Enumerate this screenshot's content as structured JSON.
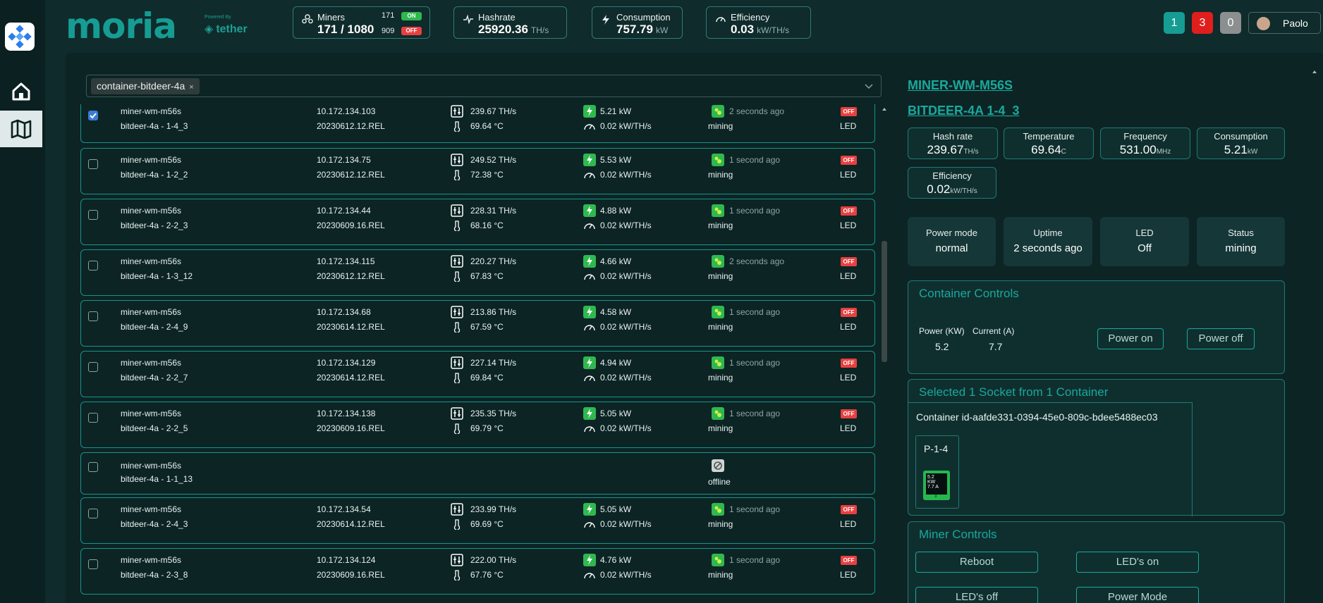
{
  "brand": {
    "name": "moria",
    "powered_by": "Powered By",
    "partner": "tether"
  },
  "stats": {
    "miners": {
      "label": "Miners",
      "value": "171 / 1080",
      "on_count": "171",
      "off_count": "909",
      "on_label": "ON",
      "off_label": "OFF"
    },
    "hashrate": {
      "label": "Hashrate",
      "value": "25920.36",
      "unit": "TH/s"
    },
    "consumption": {
      "label": "Consumption",
      "value": "757.79",
      "unit": "kW"
    },
    "efficiency": {
      "label": "Efficiency",
      "value": "0.03",
      "unit": "kW/TH/s"
    }
  },
  "badges": [
    {
      "value": "1",
      "color": "#169c93"
    },
    {
      "value": "3",
      "color": "#e01e1e"
    },
    {
      "value": "0",
      "color": "#8c8f8f"
    }
  ],
  "user": {
    "name": "Paolo"
  },
  "filter": {
    "chip": "container-bitdeer-4a",
    "chip_close": "×"
  },
  "miners": [
    {
      "model": "miner-wm-m56s",
      "pos": "bitdeer-4a - 1-4_3",
      "ip": "10.172.134.103",
      "fw": "20230612.12.REL",
      "hashrate": "239.67 TH/s",
      "temp": "69.64 °C",
      "power": "5.21 kW",
      "eff": "0.02 kW/TH/s",
      "ago": "2 seconds ago",
      "status": "mining",
      "off": "OFF",
      "led": "LED",
      "checked": true,
      "online": true
    },
    {
      "model": "miner-wm-m56s",
      "pos": "bitdeer-4a - 1-2_2",
      "ip": "10.172.134.75",
      "fw": "20230612.12.REL",
      "hashrate": "249.52 TH/s",
      "temp": "72.38 °C",
      "power": "5.53 kW",
      "eff": "0.02 kW/TH/s",
      "ago": "1 second ago",
      "status": "mining",
      "off": "OFF",
      "led": "LED",
      "checked": false,
      "online": true
    },
    {
      "model": "miner-wm-m56s",
      "pos": "bitdeer-4a - 2-2_3",
      "ip": "10.172.134.44",
      "fw": "20230609.16.REL",
      "hashrate": "228.31 TH/s",
      "temp": "68.16 °C",
      "power": "4.88 kW",
      "eff": "0.02 kW/TH/s",
      "ago": "1 second ago",
      "status": "mining",
      "off": "OFF",
      "led": "LED",
      "checked": false,
      "online": true
    },
    {
      "model": "miner-wm-m56s",
      "pos": "bitdeer-4a - 1-3_12",
      "ip": "10.172.134.115",
      "fw": "20230612.12.REL",
      "hashrate": "220.27 TH/s",
      "temp": "67.83 °C",
      "power": "4.66 kW",
      "eff": "0.02 kW/TH/s",
      "ago": "2 seconds ago",
      "status": "mining",
      "off": "OFF",
      "led": "LED",
      "checked": false,
      "online": true
    },
    {
      "model": "miner-wm-m56s",
      "pos": "bitdeer-4a - 2-4_9",
      "ip": "10.172.134.68",
      "fw": "20230614.12.REL",
      "hashrate": "213.86 TH/s",
      "temp": "67.59 °C",
      "power": "4.58 kW",
      "eff": "0.02 kW/TH/s",
      "ago": "1 second ago",
      "status": "mining",
      "off": "OFF",
      "led": "LED",
      "checked": false,
      "online": true
    },
    {
      "model": "miner-wm-m56s",
      "pos": "bitdeer-4a - 2-2_7",
      "ip": "10.172.134.129",
      "fw": "20230614.12.REL",
      "hashrate": "227.14 TH/s",
      "temp": "69.84 °C",
      "power": "4.94 kW",
      "eff": "0.02 kW/TH/s",
      "ago": "1 second ago",
      "status": "mining",
      "off": "OFF",
      "led": "LED",
      "checked": false,
      "online": true
    },
    {
      "model": "miner-wm-m56s",
      "pos": "bitdeer-4a - 2-2_5",
      "ip": "10.172.134.138",
      "fw": "20230609.16.REL",
      "hashrate": "235.35 TH/s",
      "temp": "69.79 °C",
      "power": "5.05 kW",
      "eff": "0.02 kW/TH/s",
      "ago": "1 second ago",
      "status": "mining",
      "off": "OFF",
      "led": "LED",
      "checked": false,
      "online": true
    },
    {
      "model": "miner-wm-m56s",
      "pos": "bitdeer-4a - 1-1_13",
      "status": "offline",
      "checked": false,
      "online": false
    },
    {
      "model": "miner-wm-m56s",
      "pos": "bitdeer-4a - 2-4_3",
      "ip": "10.172.134.54",
      "fw": "20230614.12.REL",
      "hashrate": "233.99 TH/s",
      "temp": "69.69 °C",
      "power": "5.05 kW",
      "eff": "0.02 kW/TH/s",
      "ago": "1 second ago",
      "status": "mining",
      "off": "OFF",
      "led": "LED",
      "checked": false,
      "online": true
    },
    {
      "model": "miner-wm-m56s",
      "pos": "bitdeer-4a - 2-3_8",
      "ip": "10.172.134.124",
      "fw": "20230609.16.REL",
      "hashrate": "222.00 TH/s",
      "temp": "67.76 °C",
      "power": "4.76 kW",
      "eff": "0.02 kW/TH/s",
      "ago": "1 second ago",
      "status": "mining",
      "off": "OFF",
      "led": "LED",
      "checked": false,
      "online": true
    }
  ],
  "detail": {
    "title1": "MINER-WM-M56S",
    "title2": "BITDEER-4A 1-4_3",
    "metrics": [
      {
        "label": "Hash rate",
        "value": "239.67",
        "unit": "TH/s"
      },
      {
        "label": "Temperature",
        "value": "69.64",
        "unit": "C"
      },
      {
        "label": "Frequency",
        "value": "531.00",
        "unit": "MHz"
      },
      {
        "label": "Consumption",
        "value": "5.21",
        "unit": "kW"
      },
      {
        "label": "Efficiency",
        "value": "0.02",
        "unit": "kW/TH/s"
      }
    ],
    "info": [
      {
        "label": "Power mode",
        "value": "normal"
      },
      {
        "label": "Uptime",
        "value": "2 seconds ago"
      },
      {
        "label": "LED",
        "value": "Off"
      },
      {
        "label": "Status",
        "value": "mining"
      }
    ],
    "container_controls": {
      "title": "Container Controls",
      "power_label": "Power (KW)",
      "power_value": "5.2",
      "current_label": "Current (A)",
      "current_value": "7.7",
      "power_on": "Power on",
      "power_off": "Power off"
    },
    "sockets": {
      "title": "Selected 1 Socket from 1 Container",
      "container_id": "Container id-aafde331-0394-45e0-809c-bdee5488ec03",
      "socket_label": "P-1-4",
      "socket_kw": "5.2",
      "socket_kw_unit": "KW",
      "socket_amp": "7.7 A",
      "socket_num": "3"
    },
    "miner_controls": {
      "title": "Miner Controls",
      "reboot": "Reboot",
      "leds_on": "LED's on",
      "leds_off": "LED's off",
      "power_mode": "Power Mode"
    }
  }
}
